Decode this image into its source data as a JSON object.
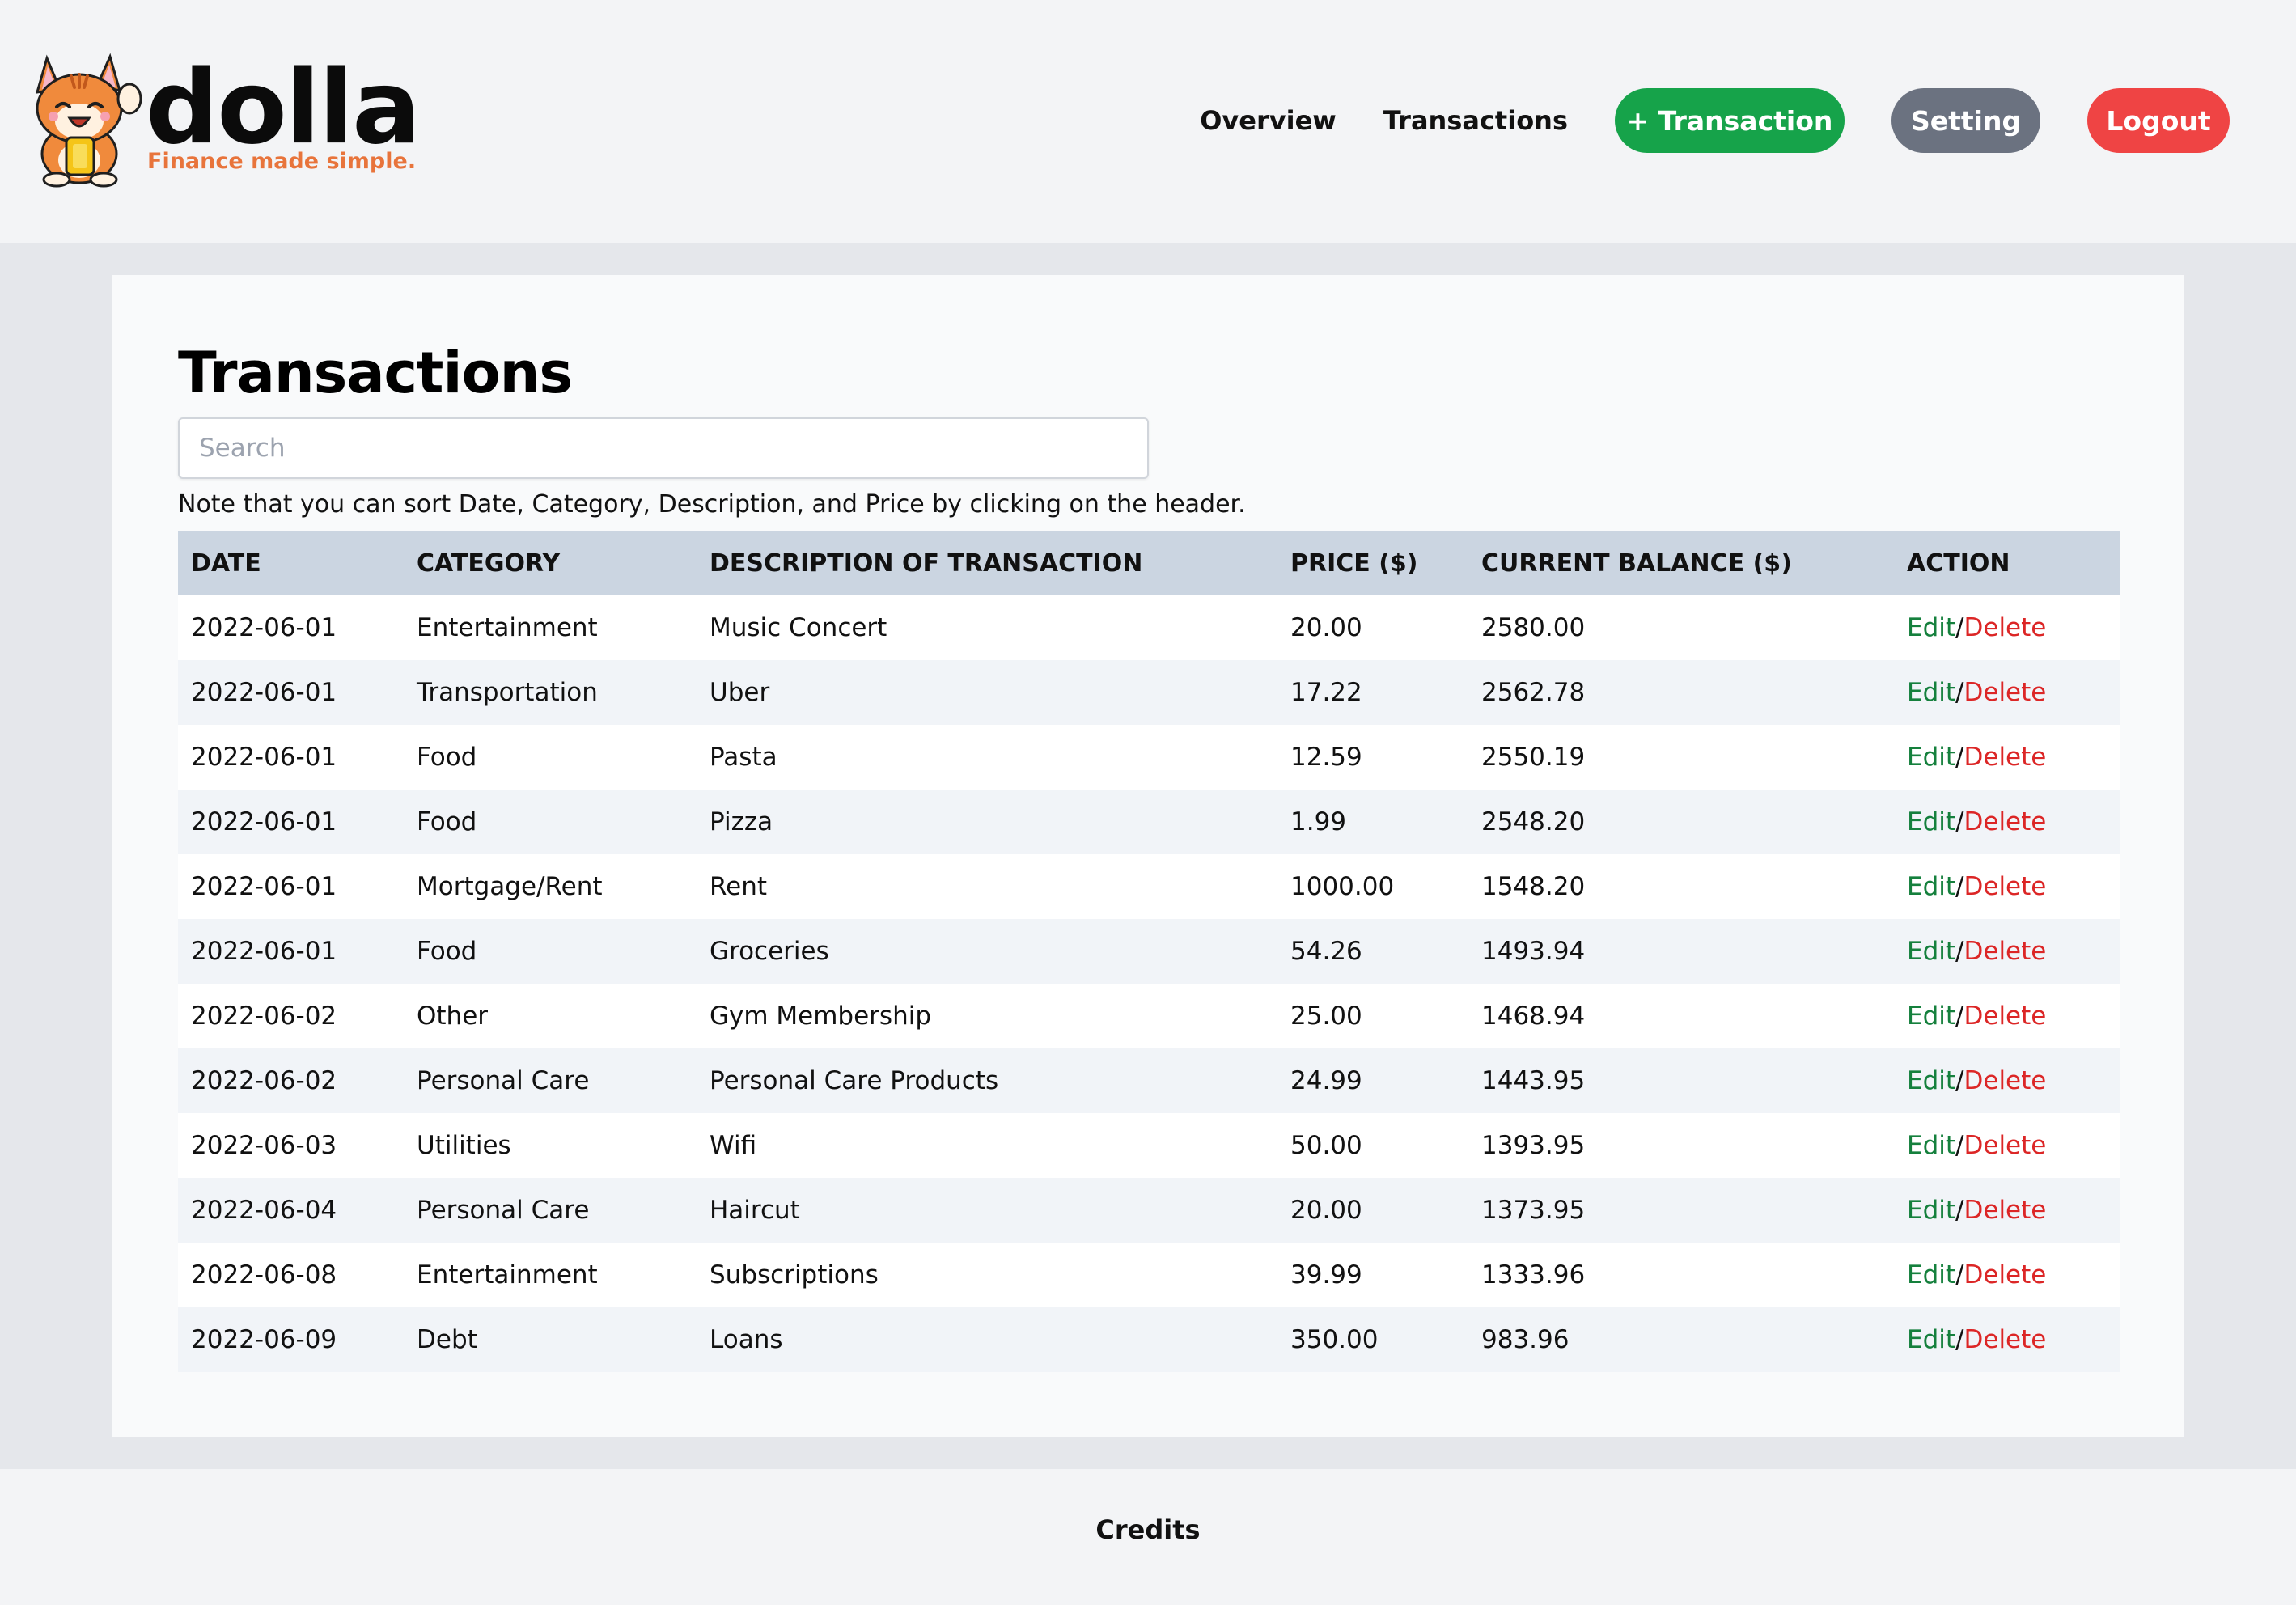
{
  "brand": {
    "name": "dolla",
    "tagline": "Finance made simple."
  },
  "nav": {
    "overview": "Overview",
    "transactions": "Transactions",
    "add_transaction": "+ Transaction",
    "setting": "Setting",
    "logout": "Logout"
  },
  "colors": {
    "add_button": "#16a34a",
    "setting_button": "#6b7280",
    "logout_button": "#ef4444",
    "edit_link": "#15803d",
    "delete_link": "#dc2626",
    "table_header": "#cbd5e1",
    "tagline": "#e8743b"
  },
  "page": {
    "title": "Transactions",
    "search_placeholder": "Search",
    "note": "Note that you can sort Date, Category, Description, and Price by clicking on the header."
  },
  "table": {
    "headers": [
      "DATE",
      "CATEGORY",
      "DESCRIPTION OF TRANSACTION",
      "PRICE ($)",
      "CURRENT BALANCE ($)",
      "ACTION"
    ],
    "edit_label": "Edit",
    "separator": "/",
    "delete_label": "Delete",
    "rows": [
      {
        "date": "2022-06-01",
        "category": "Entertainment",
        "description": "Music Concert",
        "price": "20.00",
        "balance": "2580.00"
      },
      {
        "date": "2022-06-01",
        "category": "Transportation",
        "description": "Uber",
        "price": "17.22",
        "balance": "2562.78"
      },
      {
        "date": "2022-06-01",
        "category": "Food",
        "description": "Pasta",
        "price": "12.59",
        "balance": "2550.19"
      },
      {
        "date": "2022-06-01",
        "category": "Food",
        "description": "Pizza",
        "price": "1.99",
        "balance": "2548.20"
      },
      {
        "date": "2022-06-01",
        "category": "Mortgage/Rent",
        "description": "Rent",
        "price": "1000.00",
        "balance": "1548.20"
      },
      {
        "date": "2022-06-01",
        "category": "Food",
        "description": "Groceries",
        "price": "54.26",
        "balance": "1493.94"
      },
      {
        "date": "2022-06-02",
        "category": "Other",
        "description": "Gym Membership",
        "price": "25.00",
        "balance": "1468.94"
      },
      {
        "date": "2022-06-02",
        "category": "Personal Care",
        "description": "Personal Care Products",
        "price": "24.99",
        "balance": "1443.95"
      },
      {
        "date": "2022-06-03",
        "category": "Utilities",
        "description": "Wifi",
        "price": "50.00",
        "balance": "1393.95"
      },
      {
        "date": "2022-06-04",
        "category": "Personal Care",
        "description": "Haircut",
        "price": "20.00",
        "balance": "1373.95"
      },
      {
        "date": "2022-06-08",
        "category": "Entertainment",
        "description": "Subscriptions",
        "price": "39.99",
        "balance": "1333.96"
      },
      {
        "date": "2022-06-09",
        "category": "Debt",
        "description": "Loans",
        "price": "350.00",
        "balance": "983.96"
      }
    ]
  },
  "footer": {
    "credits": "Credits"
  }
}
